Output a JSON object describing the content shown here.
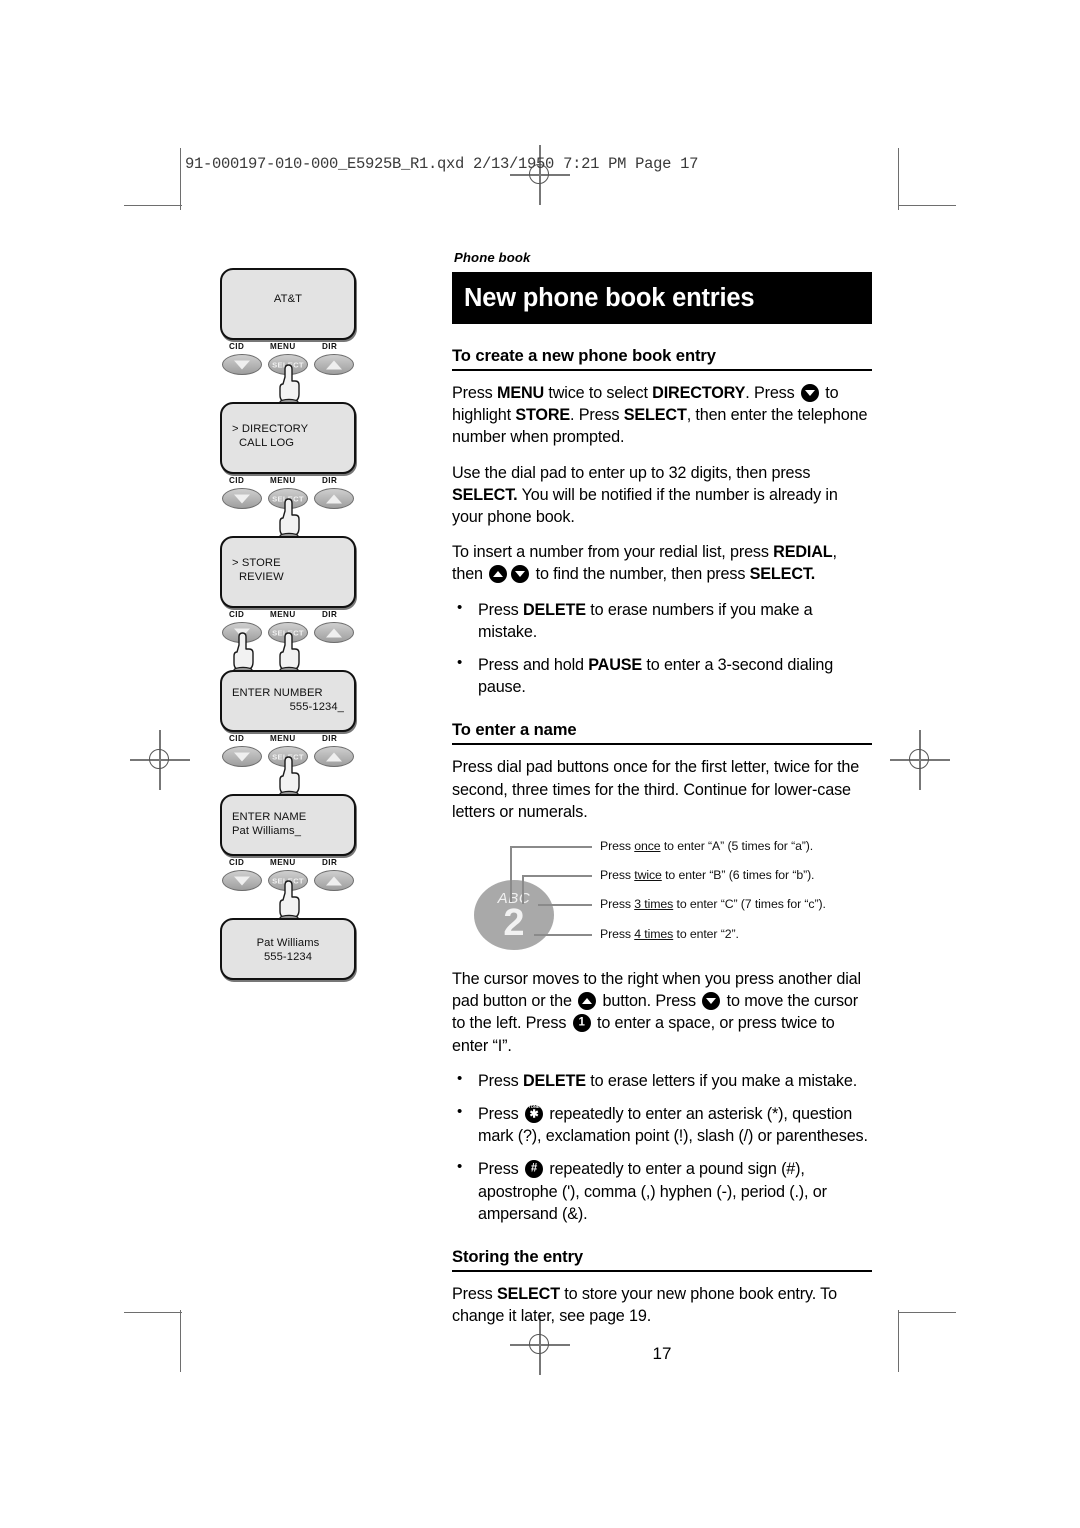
{
  "prepress": {
    "header": "91-000197-010-000_E5925B_R1.qxd  2/13/1950  7:21 PM  Page 17"
  },
  "illustration": {
    "button_labels": {
      "left": "CID",
      "center": "MENU",
      "right": "DIR"
    },
    "select_label": "SELECT",
    "panels": [
      {
        "name": "brand-screen",
        "align": "center",
        "lines": [
          "AT&T"
        ],
        "hands": [
          "center"
        ]
      },
      {
        "name": "directory-menu-screen",
        "align": "left",
        "lines": [
          "> DIRECTORY",
          "CALL LOG"
        ],
        "hands": [
          "center"
        ]
      },
      {
        "name": "store-review-screen",
        "align": "left",
        "lines": [
          "> STORE",
          "REVIEW"
        ],
        "hands": [
          "left",
          "center"
        ]
      },
      {
        "name": "enter-number-screen",
        "align": "split",
        "lines": [
          "ENTER NUMBER",
          "555-1234_"
        ],
        "hands": [
          "center"
        ]
      },
      {
        "name": "enter-name-screen",
        "align": "left",
        "lines": [
          "ENTER NAME",
          "Pat Williams_"
        ],
        "hands": [
          "center"
        ]
      },
      {
        "name": "saved-entry-screen",
        "align": "center",
        "lines": [
          "Pat Williams",
          "555-1234"
        ],
        "hands": []
      }
    ]
  },
  "content": {
    "kicker": "Phone book",
    "title": "New phone book entries",
    "section1": {
      "heading": "To create a new phone book entry",
      "p1_a": "Press ",
      "p1_menu": "MENU",
      "p1_b": " twice to select ",
      "p1_directory": "DIRECTORY",
      "p1_c": ". Press ",
      "p1_d": " to highlight ",
      "p1_store": "STORE",
      "p1_e": ". Press ",
      "p1_select": "SELECT",
      "p1_f": ", then enter the telephone number when prompted.",
      "p2_a": "Use the dial pad to enter up to 32 digits, then press ",
      "p2_select": "SELECT.",
      "p2_b": " You will be notified if the number is already in your phone book.",
      "p3_a": "To insert a number from your redial list, press ",
      "p3_redial": "REDIAL",
      "p3_b": ", then ",
      "p3_c": " to find the number, then press ",
      "p3_select": "SELECT.",
      "bullet1_a": "Press ",
      "bullet1_delete": "DELETE",
      "bullet1_b": " to erase numbers if you make a mistake.",
      "bullet2_a": "Press and hold ",
      "bullet2_pause": "PAUSE",
      "bullet2_b": " to enter a 3-second dialing pause."
    },
    "section2": {
      "heading": "To enter a name",
      "p1": "Press dial pad buttons once for the first letter, twice for the second, three times for the third. Continue for lower-case letters or numerals.",
      "callout": {
        "key_letters": "ABC",
        "key_number": "2",
        "labels": [
          {
            "pre": "Press ",
            "emph": "once",
            "post": " to enter “A” (5 times for “a”)."
          },
          {
            "pre": "Press ",
            "emph": "twice",
            "post": " to enter “B” (6 times for “b”)."
          },
          {
            "pre": "Press ",
            "emph": "3 times",
            "post": " to enter “C” (7 times for “c”)."
          },
          {
            "pre": "Press ",
            "emph": "4 times",
            "post": " to enter “2”."
          }
        ]
      },
      "p2_a": "The cursor moves to the right when you press another dial pad button or the ",
      "p2_b": " button. Press ",
      "p2_c": " to move the cursor to the left. Press ",
      "p2_d": " to enter a space, or press twice to enter “I”.",
      "bullet1_a": "Press ",
      "bullet1_delete": "DELETE",
      "bullet1_b": " to erase letters if you make a mistake.",
      "bullet2_a": "Press ",
      "bullet2_b": " repeatedly to enter an asterisk (*), question mark (?), exclamation point (!), slash (/) or parentheses.",
      "bullet3_a": "Press ",
      "bullet3_b": " repeatedly to enter a pound sign (#), apostrophe ('), comma (,) hyphen (-), period (.), or ampersand (&).",
      "star_tone_label": "TONE",
      "pound_glyph": "#",
      "one_glyph": "1"
    },
    "section3": {
      "heading": "Storing the entry",
      "p1_a": "Press ",
      "p1_select": "SELECT",
      "p1_b": " to store your new phone book entry. To change it later, see page 19."
    },
    "page_number": "17"
  }
}
